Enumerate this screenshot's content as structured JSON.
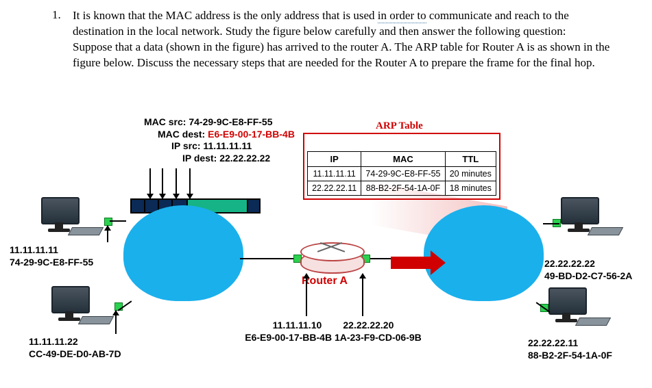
{
  "question": {
    "number": "1.",
    "text_part1": "It is known that the MAC address is the only address that is used ",
    "text_underlined": "in order to",
    "text_part2": " communicate and reach to the destination in the local network. Study the figure below carefully and then answer the following question:",
    "text_part3": "Suppose that a data (shown in the figure) has arrived to the router A. The ARP table for Router A is as shown in the figure below. Discuss the necessary steps that are needed for the Router A to prepare the frame for the final hop."
  },
  "packet_labels": {
    "mac_src": "MAC src: 74-29-9C-E8-FF-55",
    "mac_dest_prefix": "MAC dest: ",
    "mac_dest_value": "E6-E9-00-17-BB-4B",
    "ip_src": "IP src: 11.11.11.11",
    "ip_dest": "IP dest: 22.22.22.22"
  },
  "arp": {
    "title": "ARP Table",
    "headers": {
      "ip": "IP",
      "mac": "MAC",
      "ttl": "TTL"
    },
    "rows": [
      {
        "ip": "11.11.11.11",
        "mac": "74-29-9C-E8-FF-55",
        "ttl": "20 minutes"
      },
      {
        "ip": "22.22.22.11",
        "mac": "88-B2-2F-54-1A-0F",
        "ttl": "18 minutes"
      }
    ]
  },
  "router": {
    "label": "Router A",
    "left_ip": "11.11.11.10",
    "left_mac": "E6-E9-00-17-BB-4B",
    "right_ip": "22.22.22.20",
    "right_mac": "1A-23-F9-CD-06-9B"
  },
  "hosts": {
    "pc1": {
      "ip": "11.11.11.11",
      "mac": "74-29-9C-E8-FF-55"
    },
    "pc2": {
      "ip": "11.11.11.22",
      "mac": "CC-49-DE-D0-AB-7D"
    },
    "pc3": {
      "ip": "22.22.22.22",
      "mac": "49-BD-D2-C7-56-2A"
    },
    "pc4": {
      "ip": "22.22.22.11",
      "mac": "88-B2-2F-54-1A-0F"
    }
  }
}
